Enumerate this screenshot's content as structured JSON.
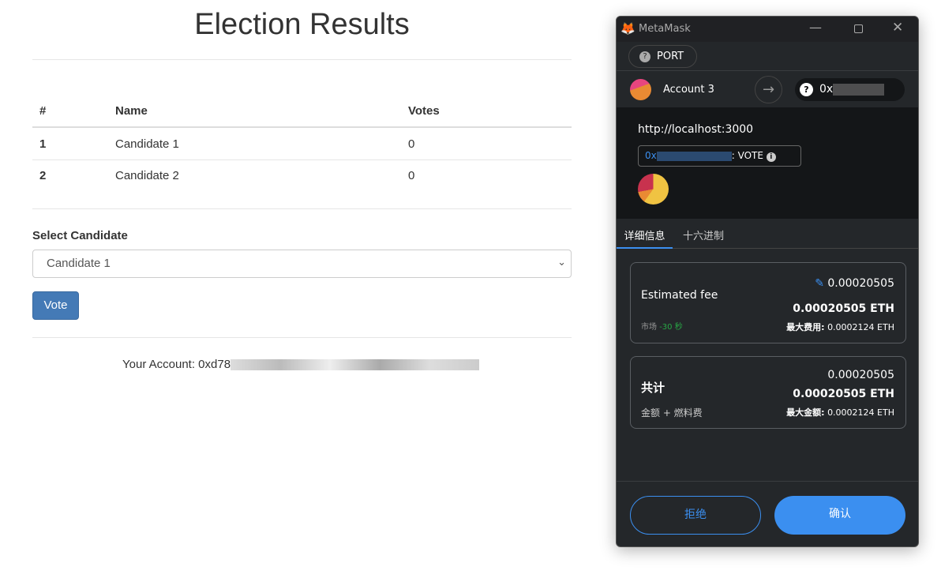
{
  "page": {
    "title": "Election Results",
    "table": {
      "headers": [
        "#",
        "Name",
        "Votes"
      ],
      "rows": [
        [
          "1",
          "Candidate 1",
          "0"
        ],
        [
          "2",
          "Candidate 2",
          "0"
        ]
      ]
    },
    "select_label": "Select Candidate",
    "select_value": "Candidate 1",
    "vote_label": "Vote",
    "account_text": "Your Account: 0xd78"
  },
  "metamask": {
    "app_title": "MetaMask",
    "network": "PORT",
    "account": "Account 3",
    "to_address_prefix": "0x",
    "origin": "http://localhost:3000",
    "contract_prefix": "0x",
    "method": ": VOTE",
    "tabs": [
      "详细信息",
      "十六进制"
    ],
    "fee": {
      "label": "Estimated fee",
      "value": "0.00020505",
      "value_eth": "0.00020505 ETH",
      "market": "市场",
      "time": "-30 秒",
      "max_label": "最大费用:",
      "max_value": "0.0002124 ETH"
    },
    "total": {
      "label": "共计",
      "value": "0.00020505",
      "value_eth": "0.00020505 ETH",
      "sub": "金额 + 燃料费",
      "max_label": "最大金额:",
      "max_value": "0.0002124 ETH"
    },
    "reject": "拒绝",
    "confirm": "确认",
    "colors": {
      "accent": "#3b8ff0",
      "green": "#28a745"
    }
  }
}
